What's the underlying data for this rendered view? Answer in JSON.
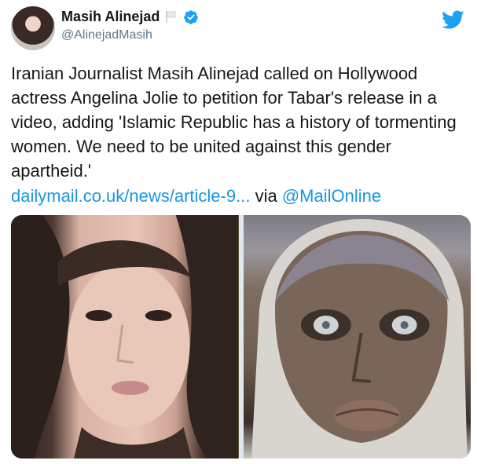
{
  "tweet": {
    "author": {
      "display_name": "Masih Alinejad",
      "handle": "@AlinejadMasih"
    },
    "text": "Iranian Journalist Masih Alinejad called on Hollywood actress Angelina Jolie to petition for Tabar's release in a video, adding 'Islamic Republic has a history of tormenting women. We need to be united against this gender apartheid.'",
    "link_text": "dailymail.co.uk/news/article-9...",
    "via_text": "via",
    "mention_text": "@MailOnline"
  },
  "colors": {
    "link": "#1b95e0",
    "verified": "#1da1f2",
    "twitter_bird": "#1da1f2",
    "handle_gray": "#657786"
  },
  "icons": [
    "flag-icon",
    "verified-icon",
    "twitter-bird-icon"
  ]
}
